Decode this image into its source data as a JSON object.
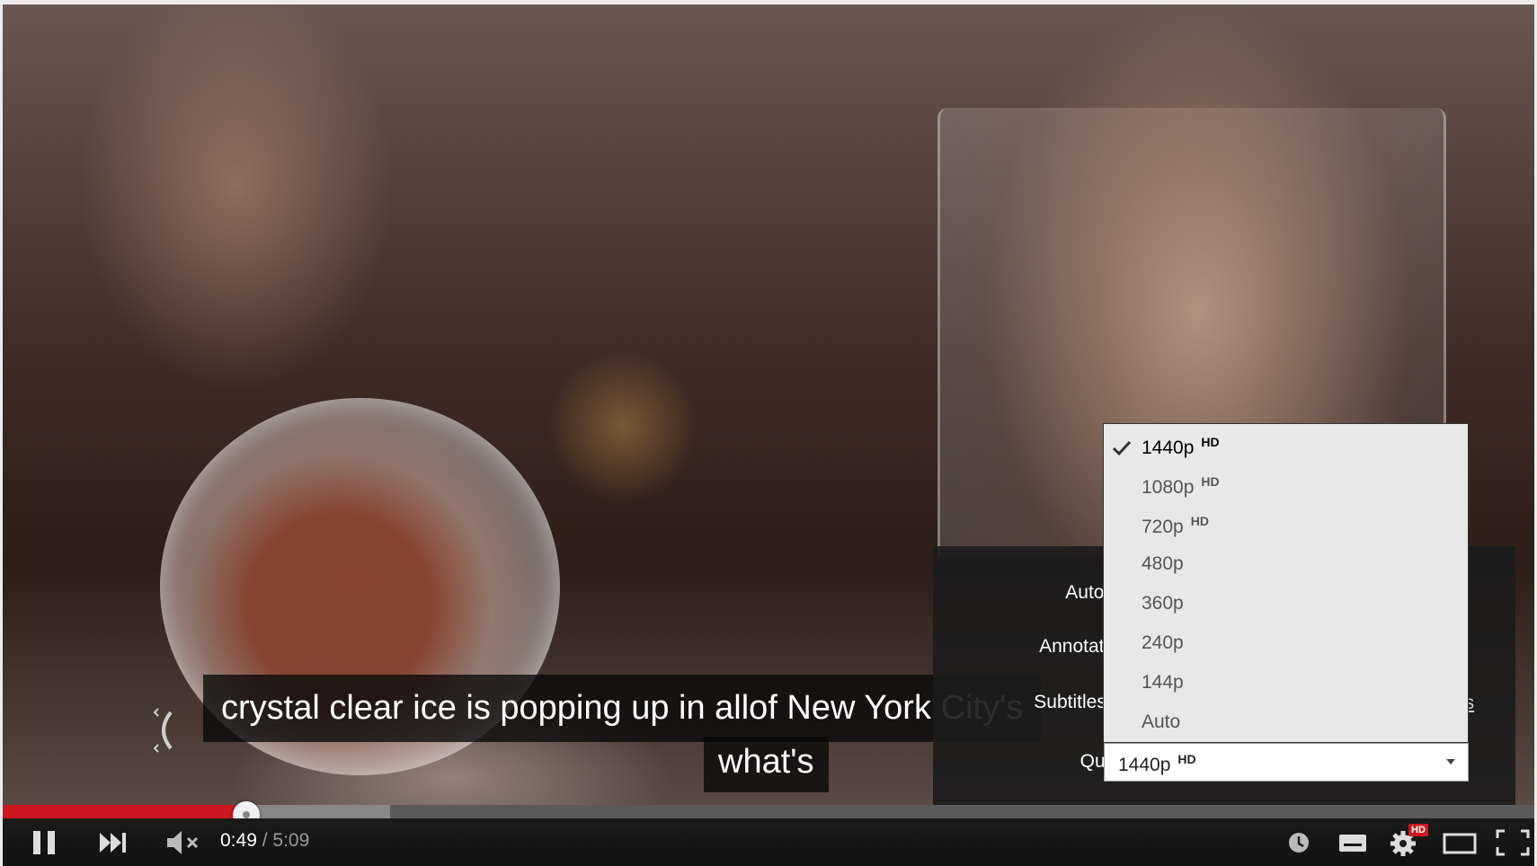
{
  "caption": {
    "line1": "crystal clear ice is popping up in allof New York City's",
    "line2": "what's"
  },
  "settings": {
    "autoplay_label": "Autoplay",
    "annotations_label": "Annotations",
    "subtitles_label": "Subtitles/CC",
    "quality_label": "Quality",
    "partial_link_text": "ns",
    "quality_value": "1440p",
    "quality_value_badge": "HD"
  },
  "quality_options": [
    {
      "label": "1440p",
      "badge": "HD",
      "selected": true
    },
    {
      "label": "1080p",
      "badge": "HD",
      "selected": false
    },
    {
      "label": "720p",
      "badge": "HD",
      "selected": false
    },
    {
      "label": "480p",
      "badge": "",
      "selected": false
    },
    {
      "label": "360p",
      "badge": "",
      "selected": false
    },
    {
      "label": "240p",
      "badge": "",
      "selected": false
    },
    {
      "label": "144p",
      "badge": "",
      "selected": false
    },
    {
      "label": "Auto",
      "badge": "",
      "selected": false
    }
  ],
  "controls": {
    "current_time": "0:49",
    "separator": " / ",
    "duration": "5:09",
    "settings_badge": "HD"
  },
  "progress": {
    "played_fraction": 0.159,
    "loaded_fraction": 0.253
  },
  "colors": {
    "accent": "#cc181e",
    "dropdown_bg": "#e8e8e8",
    "panel_bg": "#1c1c1c"
  }
}
